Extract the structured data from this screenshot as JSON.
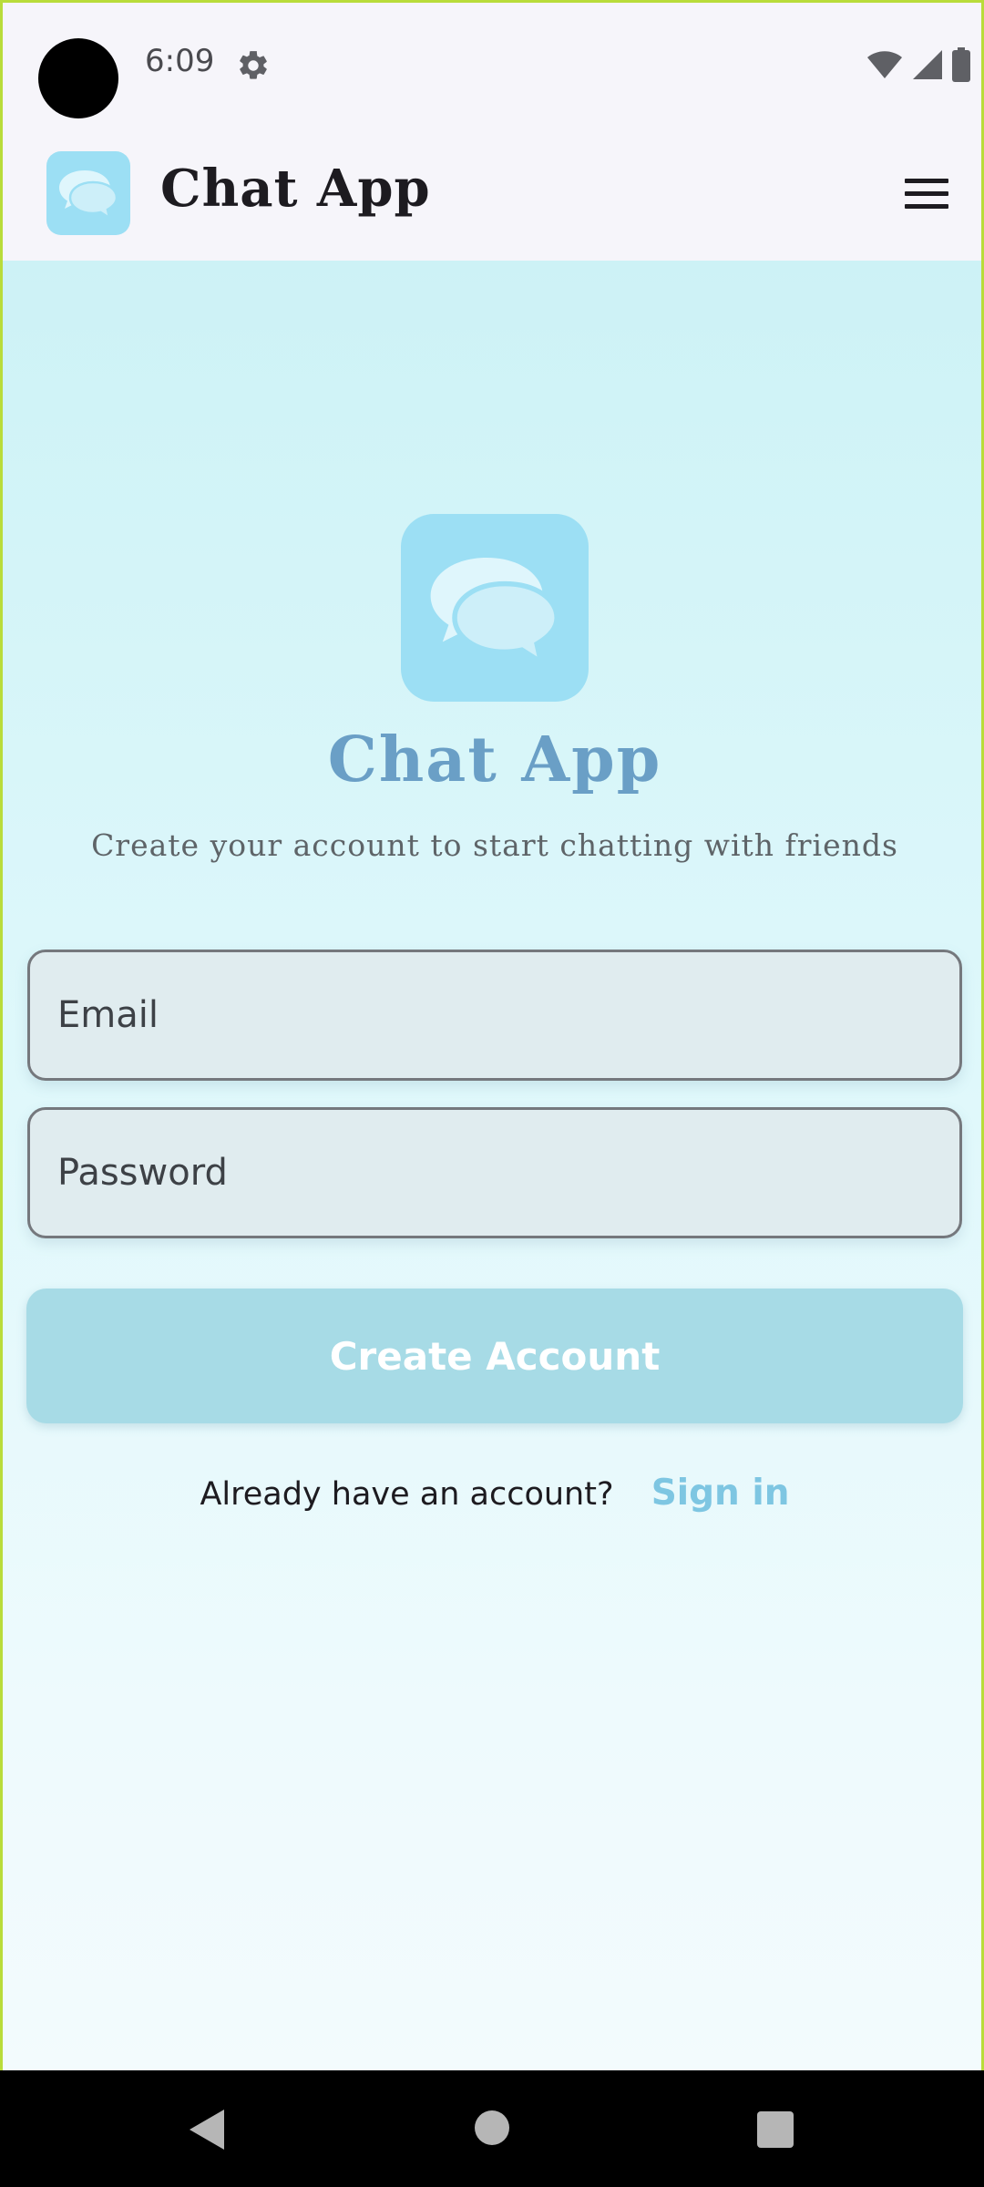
{
  "status_bar": {
    "time": "6:09",
    "icons": [
      "settings-icon",
      "wifi-icon",
      "signal-icon",
      "battery-icon"
    ]
  },
  "app_bar": {
    "title": "Chat App",
    "logo_icon": "chat-bubbles-icon",
    "menu_icon": "hamburger-menu-icon"
  },
  "hero": {
    "title": "Chat App",
    "subtitle": "Create your account to start chatting with friends"
  },
  "form": {
    "email_placeholder": "Email",
    "password_placeholder": "Password",
    "submit_label": "Create Account"
  },
  "signin": {
    "prompt": "Already have an account?",
    "link_label": "Sign in"
  },
  "nav_bar": {
    "icons": [
      "back-icon",
      "home-icon",
      "recents-icon"
    ]
  },
  "colors": {
    "accent": "#9cdff4",
    "hero_title": "#6a9fc6",
    "button": "#a7dbe6",
    "link": "#7ec6e2",
    "frame_border": "#b9dc3a"
  }
}
